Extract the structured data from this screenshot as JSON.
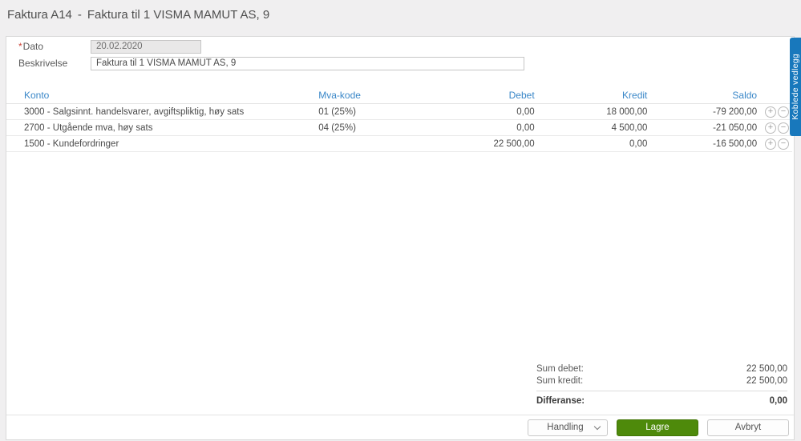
{
  "header": {
    "code": "Faktura A14",
    "dash": "-",
    "description": "Faktura til 1 VISMA MAMUT AS, 9"
  },
  "form": {
    "dato": {
      "label": "Dato",
      "required_marker": "*",
      "value": "20.02.2020"
    },
    "beskrivelse": {
      "label": "Beskrivelse",
      "value": "Faktura til 1 VISMA MAMUT AS, 9"
    }
  },
  "table": {
    "headers": {
      "konto": "Konto",
      "mva": "Mva-kode",
      "debet": "Debet",
      "kredit": "Kredit",
      "saldo": "Saldo"
    },
    "rows": [
      {
        "konto": "3000 - Salgsinnt. handelsvarer, avgiftspliktig, høy sats",
        "mva": "01 (25%)",
        "debet": "0,00",
        "kredit": "18 000,00",
        "saldo": "-79 200,00"
      },
      {
        "konto": "2700 - Utgående mva, høy sats",
        "mva": "04 (25%)",
        "debet": "0,00",
        "kredit": "4 500,00",
        "saldo": "-21 050,00"
      },
      {
        "konto": "1500 - Kundefordringer",
        "mva": "",
        "debet": "22 500,00",
        "kredit": "0,00",
        "saldo": "-16 500,00"
      }
    ],
    "row_actions": {
      "add": "+",
      "remove": "−"
    }
  },
  "totals": {
    "sum_debet_label": "Sum debet:",
    "sum_debet_value": "22 500,00",
    "sum_kredit_label": "Sum kredit:",
    "sum_kredit_value": "22 500,00",
    "differanse_label": "Differanse:",
    "differanse_value": "0,00"
  },
  "footer": {
    "handling_label": "Handling",
    "lagre_label": "Lagre",
    "avbryt_label": "Avbryt"
  },
  "side_tab": {
    "label": "Koblede vedlegg"
  },
  "colors": {
    "accent_blue": "#3a87c8",
    "tab_blue": "#1878bc",
    "save_green": "#4e8a0b",
    "required_red": "#cc4437"
  }
}
